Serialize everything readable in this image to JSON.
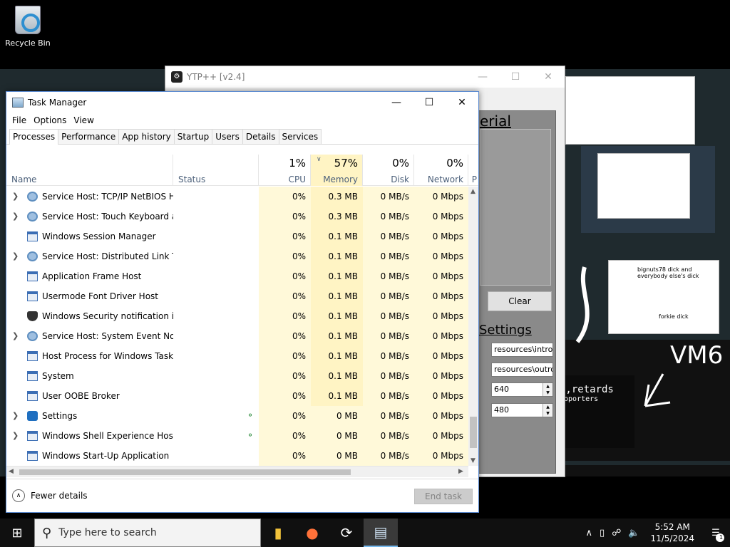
{
  "desktop": {
    "recycle_bin_label": "Recycle Bin"
  },
  "background": {
    "sketch_caption_1": "bignuts78 dick and everybody else's dick",
    "sketch_caption_2": "forkie dick",
    "handwriting": "VM6",
    "banner_text": "u,retards",
    "banner_sub": "upporters"
  },
  "ytp": {
    "title": "YTP++ [v2.4]",
    "section_material": "erial",
    "clear_label": "Clear",
    "section_settings": "Settings",
    "intro_path": "resources\\intro.r",
    "outro_path": "resources\\outro.",
    "width_value": "640",
    "height_value": "480"
  },
  "taskmanager": {
    "title": "Task Manager",
    "menu": [
      "File",
      "Options",
      "View"
    ],
    "tabs": [
      "Processes",
      "Performance",
      "App history",
      "Startup",
      "Users",
      "Details",
      "Services"
    ],
    "active_tab": "Processes",
    "columns": {
      "name": "Name",
      "status": "Status",
      "cpu": {
        "pct": "1%",
        "label": "CPU"
      },
      "memory": {
        "pct": "57%",
        "label": "Memory"
      },
      "disk": {
        "pct": "0%",
        "label": "Disk"
      },
      "network": {
        "pct": "0%",
        "label": "Network"
      },
      "power": "P"
    },
    "processes": [
      {
        "name": "Service Host: TCP/IP NetBIOS H...",
        "icon": "gear-icon",
        "expandable": true,
        "cpu": "0%",
        "memory": "0.3 MB",
        "disk": "0 MB/s",
        "network": "0 Mbps"
      },
      {
        "name": "Service Host: Touch Keyboard a...",
        "icon": "gear-icon",
        "expandable": true,
        "cpu": "0%",
        "memory": "0.3 MB",
        "disk": "0 MB/s",
        "network": "0 Mbps"
      },
      {
        "name": "Windows Session Manager",
        "icon": "window-icon",
        "expandable": false,
        "cpu": "0%",
        "memory": "0.1 MB",
        "disk": "0 MB/s",
        "network": "0 Mbps"
      },
      {
        "name": "Service Host: Distributed Link Tr...",
        "icon": "gear-icon",
        "expandable": true,
        "cpu": "0%",
        "memory": "0.1 MB",
        "disk": "0 MB/s",
        "network": "0 Mbps"
      },
      {
        "name": "Application Frame Host",
        "icon": "window-icon",
        "expandable": false,
        "cpu": "0%",
        "memory": "0.1 MB",
        "disk": "0 MB/s",
        "network": "0 Mbps"
      },
      {
        "name": "Usermode Font Driver Host",
        "icon": "window-icon",
        "expandable": false,
        "cpu": "0%",
        "memory": "0.1 MB",
        "disk": "0 MB/s",
        "network": "0 Mbps"
      },
      {
        "name": "Windows Security notification i...",
        "icon": "shield-icon",
        "expandable": false,
        "cpu": "0%",
        "memory": "0.1 MB",
        "disk": "0 MB/s",
        "network": "0 Mbps"
      },
      {
        "name": "Service Host: System Event Noti...",
        "icon": "gear-icon",
        "expandable": true,
        "cpu": "0%",
        "memory": "0.1 MB",
        "disk": "0 MB/s",
        "network": "0 Mbps"
      },
      {
        "name": "Host Process for Windows Tasks",
        "icon": "window-icon",
        "expandable": false,
        "cpu": "0%",
        "memory": "0.1 MB",
        "disk": "0 MB/s",
        "network": "0 Mbps"
      },
      {
        "name": "System",
        "icon": "window-icon",
        "expandable": false,
        "cpu": "0%",
        "memory": "0.1 MB",
        "disk": "0 MB/s",
        "network": "0 Mbps"
      },
      {
        "name": "User OOBE Broker",
        "icon": "window-icon",
        "expandable": false,
        "cpu": "0%",
        "memory": "0.1 MB",
        "disk": "0 MB/s",
        "network": "0 Mbps"
      },
      {
        "name": "Settings",
        "icon": "settings-icon",
        "expandable": true,
        "suspended": true,
        "cpu": "0%",
        "memory": "0 MB",
        "disk": "0 MB/s",
        "network": "0 Mbps"
      },
      {
        "name": "Windows Shell Experience Host",
        "icon": "window-icon",
        "expandable": true,
        "suspended": true,
        "cpu": "0%",
        "memory": "0 MB",
        "disk": "0 MB/s",
        "network": "0 Mbps"
      },
      {
        "name": "Windows Start-Up Application",
        "icon": "window-icon",
        "expandable": false,
        "cpu": "0%",
        "memory": "0 MB",
        "disk": "0 MB/s",
        "network": "0 Mbps"
      }
    ],
    "fewer_details": "Fewer details",
    "end_task": "End task"
  },
  "taskbar": {
    "search_placeholder": "Type here to search",
    "time": "5:52 AM",
    "date": "11/5/2024",
    "notification_count": "1"
  }
}
